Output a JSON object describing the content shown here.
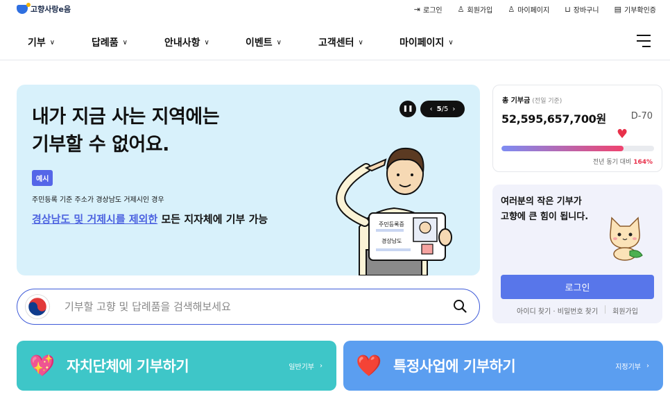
{
  "header": {
    "logo_text": "고향사랑e음",
    "util": [
      {
        "icon": "login-icon",
        "label": "로그인"
      },
      {
        "icon": "user-icon",
        "label": "회원가입"
      },
      {
        "icon": "person-icon",
        "label": "마이페이지"
      },
      {
        "icon": "basket-icon",
        "label": "장바구니"
      },
      {
        "icon": "certificate-icon",
        "label": "기부확인증"
      }
    ]
  },
  "nav": [
    {
      "label": "기부"
    },
    {
      "label": "답례품"
    },
    {
      "label": "안내사항"
    },
    {
      "label": "이벤트"
    },
    {
      "label": "고객센터"
    },
    {
      "label": "마이페이지"
    }
  ],
  "hero": {
    "title": "내가 지금 사는 지역에는\n기부할 수 없어요.",
    "badge": "예시",
    "condition": "주민등록 기준 주소가 경상남도 거제시인 경우",
    "highlight_link": "경상남도 및 거제시를 제외한",
    "highlight_rest": " 모든 지자체에 기부 가능",
    "card_title": "주민등록증",
    "card_region": "경상남도",
    "page_current": "5",
    "page_total": "/5"
  },
  "total": {
    "label": "총 기부금",
    "label_note": "(전일 기준)",
    "amount": "52,595,657,700원",
    "dday": "D-70",
    "comparison_label": "전년 동기 대비",
    "comparison_value": "164%",
    "progress_fraction": 0.8
  },
  "login_card": {
    "message": "여러분의 작은 기부가\n고향에 큰 힘이 됩니다.",
    "button": "로그인",
    "find_link": "아이디 찾기 · 비밀번호 찾기",
    "join_link": "회원가입"
  },
  "search": {
    "placeholder": "기부할 고향 및 답례품을 검색해보세요"
  },
  "cta": [
    {
      "title": "자치단체에 기부하기",
      "sub": "일반기부",
      "icon": "heart-ribbon-icon"
    },
    {
      "title": "특정사업에 기부하기",
      "sub": "지정기부",
      "icon": "heart-hand-icon"
    }
  ],
  "colors": {
    "primary": "#5876ea",
    "hero_bg": "#d8f1fb",
    "cta_left": "#3ec6c8",
    "cta_right": "#5b9ef0",
    "accent_red": "#e8304a"
  }
}
